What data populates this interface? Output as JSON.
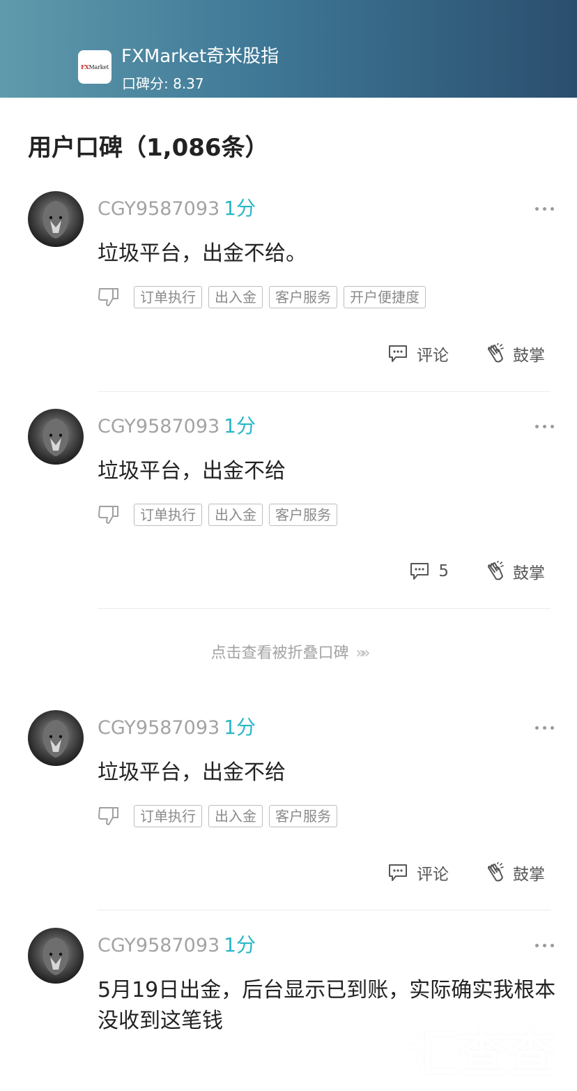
{
  "header": {
    "logo_text_prefix": "FX",
    "logo_text_suffix": "Market",
    "app_name": "FXMarket奇米股指",
    "rating_label": "口碑分: 8.37"
  },
  "section": {
    "title": "用户口碑（1,086条）"
  },
  "reviews": [
    {
      "username": "CGY9587093",
      "score": "1分",
      "content": "垃圾平台，出金不给。",
      "tags": [
        "订单执行",
        "出入金",
        "客户服务",
        "开户便捷度"
      ],
      "comment_label": "评论",
      "applaud_label": "鼓掌"
    },
    {
      "username": "CGY9587093",
      "score": "1分",
      "content": "垃圾平台，出金不给",
      "tags": [
        "订单执行",
        "出入金",
        "客户服务"
      ],
      "comment_label": "5",
      "applaud_label": "鼓掌"
    },
    {
      "username": "CGY9587093",
      "score": "1分",
      "content": "垃圾平台，出金不给",
      "tags": [
        "订单执行",
        "出入金",
        "客户服务"
      ],
      "comment_label": "评论",
      "applaud_label": "鼓掌"
    },
    {
      "username": "CGY9587093",
      "score": "1分",
      "content": "5月19日出金，后台显示已到账，实际确实我根本没收到这笔钱"
    }
  ],
  "fold": {
    "label": "点击查看被折叠口碑",
    "chevron": "»»"
  },
  "watermark": {
    "text": "汇查查"
  },
  "colors": {
    "accent": "#29b6c6",
    "header_start": "#5f9aac",
    "header_end": "#2b4e6e"
  }
}
